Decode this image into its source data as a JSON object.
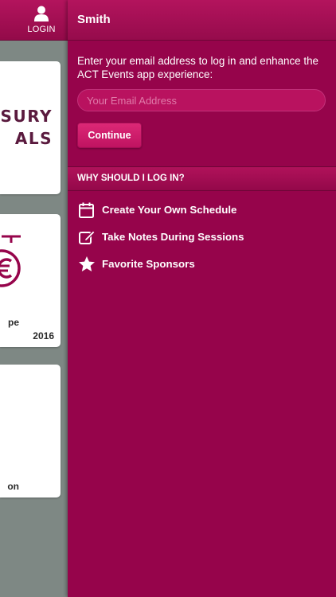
{
  "nav": {
    "login_label": "LOGIN",
    "login_icon": "user-icon"
  },
  "cards": [
    {
      "line1": "ASURY",
      "line2": "ALS"
    },
    {
      "caption1": "pe",
      "caption2": "2016",
      "logo_icon": "euro-icon"
    },
    {
      "caption1": "on"
    }
  ],
  "panel": {
    "title": "Smith",
    "intro_text": "Enter your email address to log in and enhance the ACT Events app experience:",
    "email_placeholder": "Your Email Address",
    "email_value": "",
    "continue_label": "Continue",
    "section_title": "WHY SHOULD I LOG IN?",
    "benefits": [
      {
        "icon": "calendar-icon",
        "label": "Create Your Own Schedule"
      },
      {
        "icon": "edit-note-icon",
        "label": "Take Notes During Sessions"
      },
      {
        "icon": "star-icon",
        "label": "Favorite Sponsors"
      }
    ]
  },
  "colors": {
    "brand": "#96044b",
    "header_top": "#b3145d",
    "button": "#dc2876",
    "background_gray": "#7e8884"
  }
}
